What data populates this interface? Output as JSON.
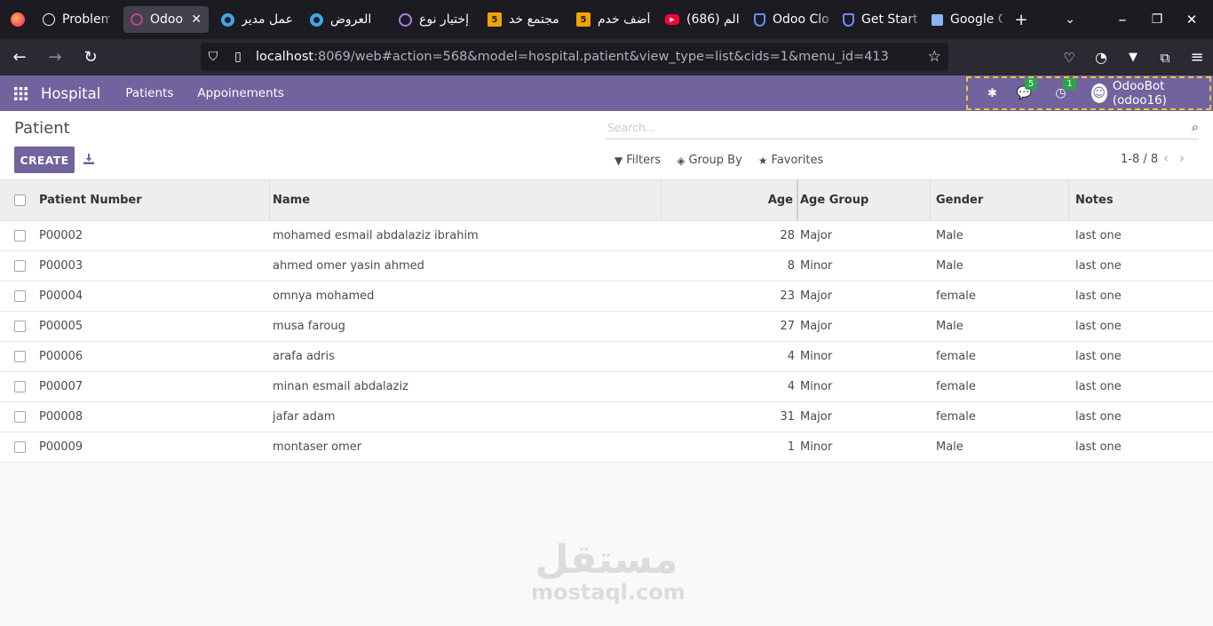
{
  "browser": {
    "tabs": [
      {
        "label": "Problem",
        "icon": "globe-icon",
        "color": "#fbfbfe"
      },
      {
        "label": "Odoo",
        "icon": "odoo-icon",
        "color": "#c1428f",
        "active": true
      },
      {
        "label": "عمل مدير",
        "icon": "circle-icon",
        "color": "#3aa9e8"
      },
      {
        "label": "العروض",
        "icon": "circle-icon",
        "color": "#3aa9e8"
      },
      {
        "label": "إختيار نوع",
        "icon": "tor-icon",
        "color": "#b27ae6"
      },
      {
        "label": "مجتمع خد",
        "icon": "five-icon",
        "color": "#f0a500"
      },
      {
        "label": "أضف خدم",
        "icon": "five-icon",
        "color": "#f0a500"
      },
      {
        "label": "(686) الم",
        "icon": "youtube-icon",
        "color": "#ff0033"
      },
      {
        "label": "Odoo Clo",
        "icon": "shield-icon",
        "color": "#6b8cff"
      },
      {
        "label": "Get Start",
        "icon": "shield-icon",
        "color": "#6b8cff"
      },
      {
        "label": "Google C",
        "icon": "gift-icon",
        "color": "#8ab4f8"
      }
    ],
    "five_label": "5",
    "url_host": "localhost",
    "url_path": ":8069/web#action=568&model=hospital.patient&view_type=list&cids=1&menu_id=413"
  },
  "odoo": {
    "app_name": "Hospital",
    "menu": [
      "Patients",
      "Appoinements"
    ],
    "messages_badge": "5",
    "activities_badge": "1",
    "user": "OdooBot (odoo16)"
  },
  "control_panel": {
    "breadcrumb": "Patient",
    "create_label": "CREATE",
    "search_placeholder": "Search...",
    "filters_label": "Filters",
    "groupby_label": "Group By",
    "favorites_label": "Favorites",
    "pager": "1-8 / 8"
  },
  "table": {
    "headers": {
      "number": "Patient Number",
      "name": "Name",
      "age": "Age",
      "age_group": "Age Group",
      "gender": "Gender",
      "notes": "Notes"
    },
    "rows": [
      {
        "number": "P00002",
        "name": "mohamed esmail abdalaziz ibrahim",
        "age": "28",
        "age_group": "Major",
        "gender": "Male",
        "notes": "last one"
      },
      {
        "number": "P00003",
        "name": "ahmed omer yasin ahmed",
        "age": "8",
        "age_group": "Minor",
        "gender": "Male",
        "notes": "last one"
      },
      {
        "number": "P00004",
        "name": "omnya mohamed",
        "age": "23",
        "age_group": "Major",
        "gender": "female",
        "notes": "last one"
      },
      {
        "number": "P00005",
        "name": "musa faroug",
        "age": "27",
        "age_group": "Major",
        "gender": "Male",
        "notes": "last one"
      },
      {
        "number": "P00006",
        "name": "arafa adris",
        "age": "4",
        "age_group": "Minor",
        "gender": "female",
        "notes": "last one"
      },
      {
        "number": "P00007",
        "name": "minan esmail abdalaziz",
        "age": "4",
        "age_group": "Minor",
        "gender": "female",
        "notes": "last one"
      },
      {
        "number": "P00008",
        "name": "jafar adam",
        "age": "31",
        "age_group": "Major",
        "gender": "female",
        "notes": "last one"
      },
      {
        "number": "P00009",
        "name": "montaser omer",
        "age": "1",
        "age_group": "Minor",
        "gender": "Male",
        "notes": "last one"
      }
    ]
  },
  "watermark": {
    "arabic": "مستقل",
    "latin": "mostaql.com"
  },
  "colors": {
    "odoo_primary": "#71639e",
    "browser_dark": "#1c1b22",
    "browser_nav": "#2b2a33",
    "badge_green": "#28a745",
    "systray_outline": "#f0c23b"
  }
}
